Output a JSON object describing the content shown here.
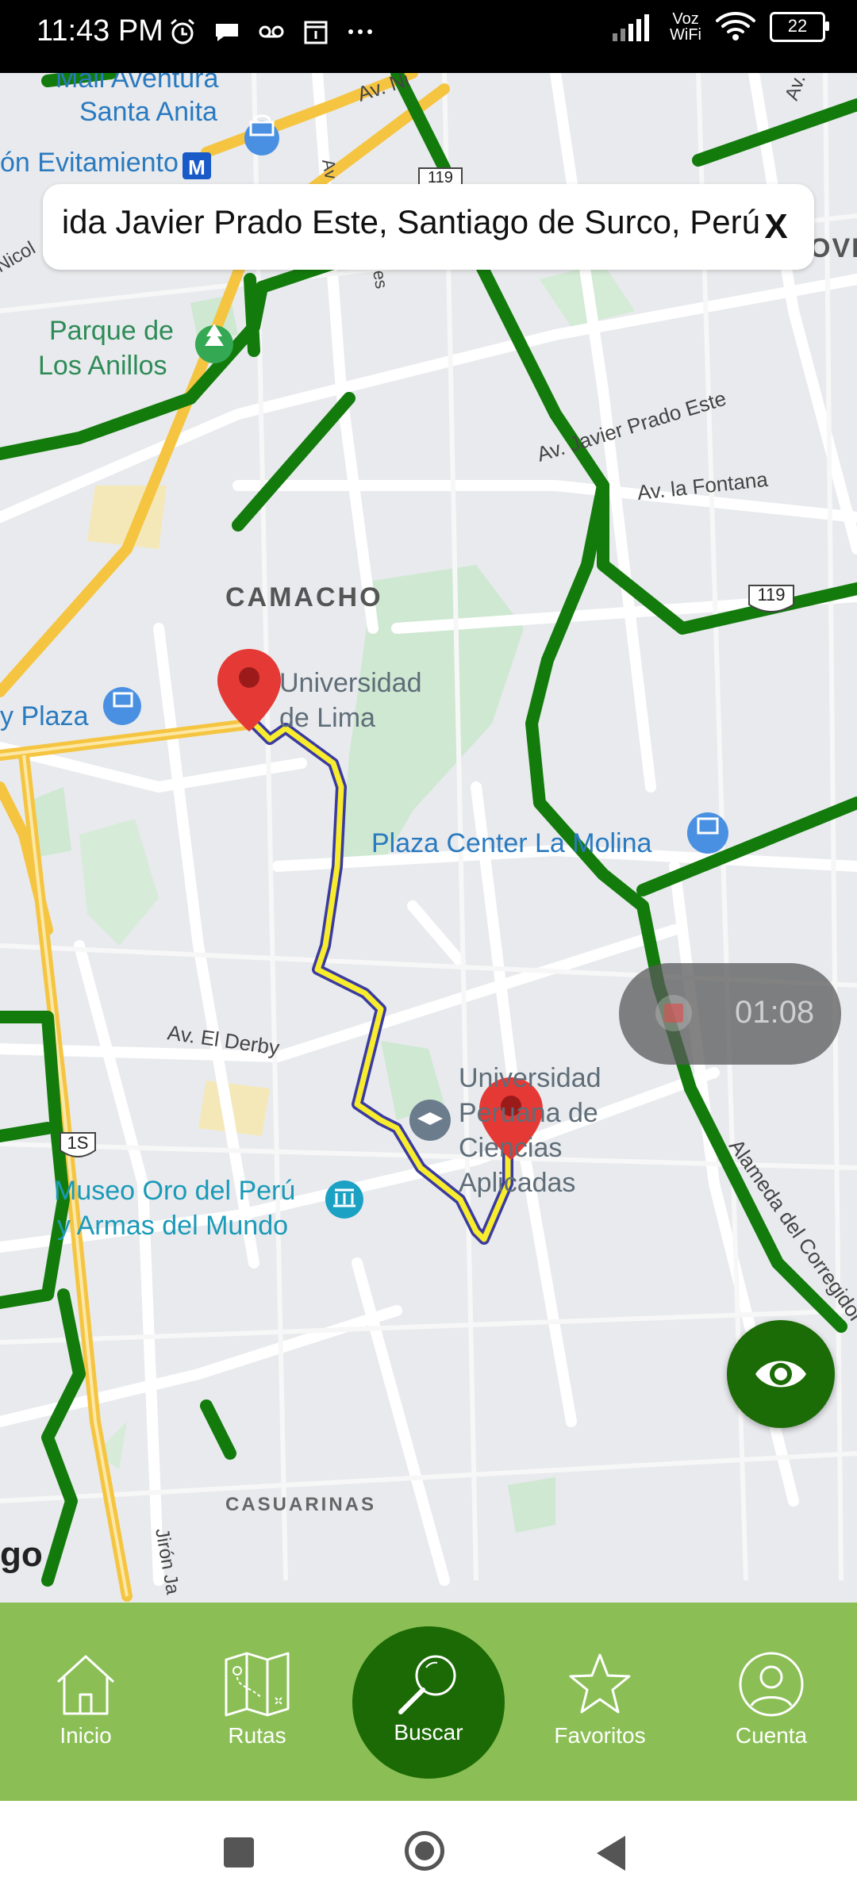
{
  "status_bar": {
    "time": "11:43 PM",
    "voz_line1": "Voz",
    "voz_line2": "WiFi",
    "battery": "22"
  },
  "search": {
    "value": "Avenida Javier Prado Este, Santiago de Surco, Perú",
    "clear_label": "X"
  },
  "map_labels": {
    "mall_line1": "Mall Aventura",
    "mall_line2": "Santa Anita",
    "evitamiento": "ón Evitamiento",
    "parque_line1": "Parque de",
    "parque_line2": "Los Anillos",
    "camacho": "CAMACHO",
    "ulima_line1": "Universidad",
    "ulima_line2": "de Lima",
    "plaza_left": "y Plaza",
    "plaza_center": "Plaza Center La Molina",
    "upc_line1": "Universidad",
    "upc_line2": "Peruana de",
    "upc_line3": "Ciencias",
    "upc_line4": "Aplicadas",
    "museo_line1": "Museo Oro del Perú",
    "museo_line2": "y Armas del Mundo",
    "casuarinas": "CASUARINAS",
    "javier_prado": "Av. Javier Prado Este",
    "la_fontana": "Av. la Fontana",
    "el_derby": "Av. El Derby",
    "alameda": "Alameda del Corregidor",
    "huarochiri": "Av. Huarochirí",
    "av_ni": "Av. Ni",
    "nicol": "Nicol",
    "ovi": "OVI",
    "jiron": "Jirón Ja",
    "route_119_a": "119",
    "route_119_b": "119",
    "route_1s": "1S",
    "go": "go",
    "av_small": "Av",
    "es_small": "es"
  },
  "timer": {
    "time": "01:08"
  },
  "nav": {
    "inicio": "Inicio",
    "rutas": "Rutas",
    "buscar": "Buscar",
    "favoritos": "Favoritos",
    "cuenta": "Cuenta"
  }
}
